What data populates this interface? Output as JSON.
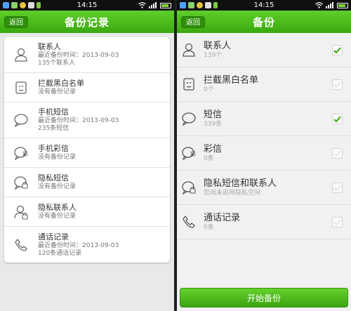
{
  "status_bar": {
    "time": "14:15"
  },
  "backup_records": {
    "title": "备份记录",
    "back_label": "返回",
    "items": [
      {
        "icon": "contacts-icon",
        "name": "联系人",
        "line1": "最近备份时间：2013-09-03",
        "line2": "135个联系人"
      },
      {
        "icon": "blocklist-icon",
        "name": "拦截黑白名单",
        "line1": "没有备份记录",
        "line2": ""
      },
      {
        "icon": "sms-icon",
        "name": "手机短信",
        "line1": "最近备份时间：2013-09-03",
        "line2": "235条短信"
      },
      {
        "icon": "mms-icon",
        "name": "手机彩信",
        "line1": "没有备份记录",
        "line2": ""
      },
      {
        "icon": "private-sms-icon",
        "name": "隐私短信",
        "line1": "没有备份记录",
        "line2": ""
      },
      {
        "icon": "private-contacts-icon",
        "name": "隐私联系人",
        "line1": "没有备份记录",
        "line2": ""
      },
      {
        "icon": "call-log-icon",
        "name": "通话记录",
        "line1": "最近备份时间：2013-09-03",
        "line2": "120条通话记录"
      }
    ]
  },
  "backup": {
    "title": "备份",
    "back_label": "返回",
    "items": [
      {
        "icon": "contacts-icon",
        "name": "联系人",
        "sub": "139个",
        "checked": true
      },
      {
        "icon": "blocklist-icon",
        "name": "拦截黑白名单",
        "sub": "0个",
        "checked": false
      },
      {
        "icon": "sms-icon",
        "name": "短信",
        "sub": "339条",
        "checked": true
      },
      {
        "icon": "mms-icon",
        "name": "彩信",
        "sub": "0条",
        "checked": false
      },
      {
        "icon": "private-icon",
        "name": "隐私短信和联系人",
        "sub": "您尚未启用隐私空间",
        "checked": false
      },
      {
        "icon": "call-log-icon",
        "name": "通话记录",
        "sub": "0条",
        "checked": false
      }
    ],
    "start_label": "开始备份"
  },
  "colors": {
    "accent": "#3aa90f",
    "check": "#3aa90f"
  }
}
